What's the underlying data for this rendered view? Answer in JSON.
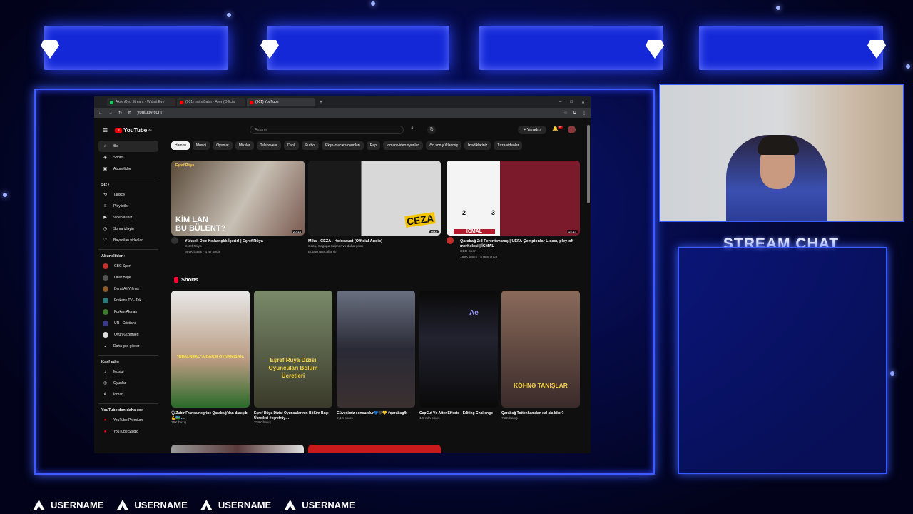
{
  "overlay": {
    "chat_title": "STREAM CHAT",
    "usernames": [
      "USERNAME",
      "USERNAME",
      "USERNAME",
      "USERNAME"
    ],
    "accent": "#1428d8"
  },
  "browser": {
    "tabs": [
      {
        "label": "AkomOyo Stream · Widrrit Eve",
        "color": "#22c55e"
      },
      {
        "label": "(901) İmirs Batar · Ayer (Official",
        "color": "#ff0000"
      },
      {
        "label": "(901) YouTube",
        "color": "#ff0000",
        "active": true
      }
    ],
    "url": "youtube.com"
  },
  "youtube": {
    "logo": "YouTube",
    "logo_sup": "AZ",
    "search_placeholder": "Axtarın",
    "create_label": "+ Yaradın",
    "bell_badge": "9+",
    "sidebar": {
      "main": [
        {
          "icon": "home-icon",
          "glyph": "⌂",
          "label": "Əv",
          "active": true
        },
        {
          "icon": "shorts-icon",
          "glyph": "◈",
          "label": "Shorts"
        },
        {
          "icon": "subscriptions-icon",
          "glyph": "▣",
          "label": "Abunəliklər"
        }
      ],
      "you_head": "Siz  ›",
      "you": [
        {
          "icon": "history-icon",
          "glyph": "⟲",
          "label": "Tarixçə"
        },
        {
          "icon": "playlists-icon",
          "glyph": "≡",
          "label": "Pleylistlər"
        },
        {
          "icon": "your-videos-icon",
          "glyph": "▶",
          "label": "Videolarınız"
        },
        {
          "icon": "watch-later-icon",
          "glyph": "◷",
          "label": "Sonra izləyin"
        },
        {
          "icon": "liked-videos-icon",
          "glyph": "👍",
          "label": "Bəyənilən videolar"
        }
      ],
      "subs_head": "Abunəliklər  ›",
      "subs": [
        {
          "label": "CBC Sport",
          "color": "#c4302b"
        },
        {
          "label": "Onur Bilge",
          "color": "#555"
        },
        {
          "label": "Berat Ali Yılmaz",
          "color": "#8b5a2b"
        },
        {
          "label": "Frekans TV - Tek…",
          "color": "#2c7a7b"
        },
        {
          "label": "Furkan Akman",
          "color": "#3b7a2b"
        },
        {
          "label": "UR · Cristiano",
          "color": "#3a3a8a"
        },
        {
          "label": "Oyun Gizemleri",
          "color": "#ddd"
        },
        {
          "label": "Daha çox göstər",
          "color": "#0f0f0f"
        }
      ],
      "explore_head": "Kəşf edin",
      "explore": [
        {
          "icon": "music-icon",
          "glyph": "♪",
          "label": "Musiqi"
        },
        {
          "icon": "gaming-icon",
          "glyph": "◎",
          "label": "Oyunlar"
        },
        {
          "icon": "sports-icon",
          "glyph": "🏆",
          "label": "İdman"
        }
      ],
      "more_head": "YouTube'dan daha çox",
      "more": [
        {
          "icon": "premium-icon",
          "label": "YouTube Premium"
        },
        {
          "icon": "studio-icon",
          "label": "YouTube Studio"
        }
      ]
    },
    "chips": [
      "Hamısı",
      "Musiqi",
      "Oyunlar",
      "Miksler",
      "Telenovela",
      "Canlı",
      "Futbol",
      "Ekşn-macəra oyunları",
      "Rep",
      "İdman video oyunları",
      "Ən son yüklənmiş",
      "İzlədikləriniz",
      "Təzə videolar"
    ],
    "videos": [
      {
        "title": "Yüksek Doz Kıskançlık İçerir! | Eşref Rüya",
        "channel": "Eşref Rüya",
        "meta": "989K baxış · 4 ay öncə",
        "duration": "20:14",
        "overlay_text": "KİM LAN\nBU BÜLENT?",
        "badge": "Eşref Rüya"
      },
      {
        "title": "Miks - CEZA - Holocaust (Official Audio)",
        "channel": "Ceza, Sagopa Kajmer və daha çoxu",
        "meta": "Bugün güncəllənib",
        "duration": "Miks",
        "overlay_text": "CEZA"
      },
      {
        "title": "Qarabağ 2:3 Ferentsvaroş | UEFA Çempionlar Liqası, pley-off mərhələsi | İCMAL",
        "channel": "CBC Sport",
        "meta": "189K baxış · 5 gün öncə",
        "duration": "14:14",
        "score_home": "2",
        "score_away": "3",
        "overlay_text": "İCMAL"
      }
    ],
    "shorts_head": "Shorts",
    "shorts": [
      {
        "title": "🗣Zubir Fransa nəgrinə Qarabağ'dan danışıb 💪🇦🇿 …",
        "views": "76K baxış",
        "overlay_text": "\"REALREAL\"A DARŞI OYNAMISAN."
      },
      {
        "title": "Eşref Rüya Dizisi Oyuncularının Bölüm Başı Ücretleri #eşrefrüy…",
        "views": "338K baxış",
        "overlay_text": "Eşref Rüya Dizisi Oyuncuları Bölüm Ücretleri"
      },
      {
        "title": "Güvenimiz sonsuzdur💙🖤💛 #qarabagfk",
        "views": "2,1K baxış",
        "overlay_text": ""
      },
      {
        "title": "CapCut Vs After Effects - Editing Challenge",
        "views": "1,5 mln baxış",
        "overlay_text": "Ae"
      },
      {
        "title": "Qarabağ Tottenhamdan xal ala bilər?",
        "views": "7,2K baxış",
        "overlay_text": "KÖHNƏ TANIŞLAR"
      }
    ]
  }
}
